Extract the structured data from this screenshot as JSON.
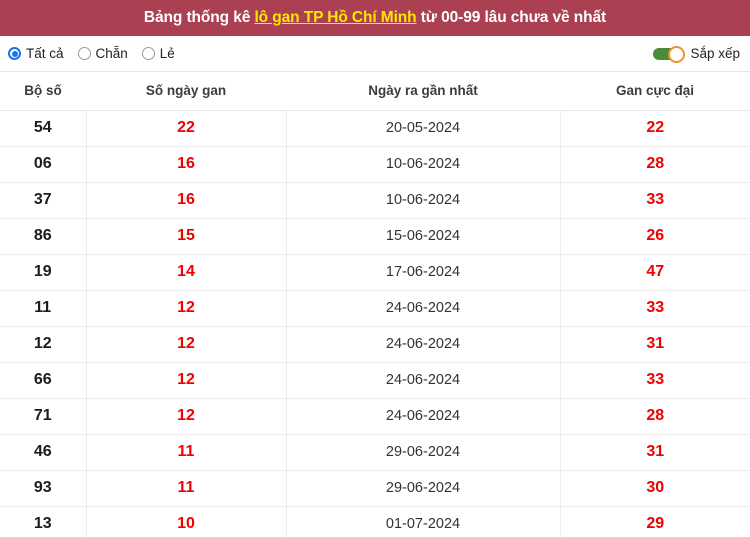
{
  "header": {
    "title_prefix": "Bảng thống kê ",
    "title_link": "lô gan TP Hồ Chí Minh",
    "title_suffix": " từ 00-99 lâu chưa về nhất",
    "banner_color": "#ac4053",
    "link_color": "#ffe600"
  },
  "controls": {
    "radios": [
      {
        "label": "Tất cả",
        "selected": true
      },
      {
        "label": "Chẵn",
        "selected": false
      },
      {
        "label": "Lẻ",
        "selected": false
      }
    ],
    "sort": {
      "label": "Sắp xếp",
      "enabled": true,
      "track_color": "#4b8b38",
      "knob_color": "#f0922b"
    }
  },
  "table": {
    "columns": [
      "Bộ số",
      "Số ngày gan",
      "Ngày ra gần nhất",
      "Gan cực đại"
    ],
    "highlight_color": "#f00000",
    "rows": [
      {
        "bo_so": "54",
        "so_ngay_gan": "22",
        "ngay_ra_gan_nhat": "20-05-2024",
        "gan_cuc_dai": "22"
      },
      {
        "bo_so": "06",
        "so_ngay_gan": "16",
        "ngay_ra_gan_nhat": "10-06-2024",
        "gan_cuc_dai": "28"
      },
      {
        "bo_so": "37",
        "so_ngay_gan": "16",
        "ngay_ra_gan_nhat": "10-06-2024",
        "gan_cuc_dai": "33"
      },
      {
        "bo_so": "86",
        "so_ngay_gan": "15",
        "ngay_ra_gan_nhat": "15-06-2024",
        "gan_cuc_dai": "26"
      },
      {
        "bo_so": "19",
        "so_ngay_gan": "14",
        "ngay_ra_gan_nhat": "17-06-2024",
        "gan_cuc_dai": "47"
      },
      {
        "bo_so": "11",
        "so_ngay_gan": "12",
        "ngay_ra_gan_nhat": "24-06-2024",
        "gan_cuc_dai": "33"
      },
      {
        "bo_so": "12",
        "so_ngay_gan": "12",
        "ngay_ra_gan_nhat": "24-06-2024",
        "gan_cuc_dai": "31"
      },
      {
        "bo_so": "66",
        "so_ngay_gan": "12",
        "ngay_ra_gan_nhat": "24-06-2024",
        "gan_cuc_dai": "33"
      },
      {
        "bo_so": "71",
        "so_ngay_gan": "12",
        "ngay_ra_gan_nhat": "24-06-2024",
        "gan_cuc_dai": "28"
      },
      {
        "bo_so": "46",
        "so_ngay_gan": "11",
        "ngay_ra_gan_nhat": "29-06-2024",
        "gan_cuc_dai": "31"
      },
      {
        "bo_so": "93",
        "so_ngay_gan": "11",
        "ngay_ra_gan_nhat": "29-06-2024",
        "gan_cuc_dai": "30"
      },
      {
        "bo_so": "13",
        "so_ngay_gan": "10",
        "ngay_ra_gan_nhat": "01-07-2024",
        "gan_cuc_dai": "29"
      }
    ]
  }
}
